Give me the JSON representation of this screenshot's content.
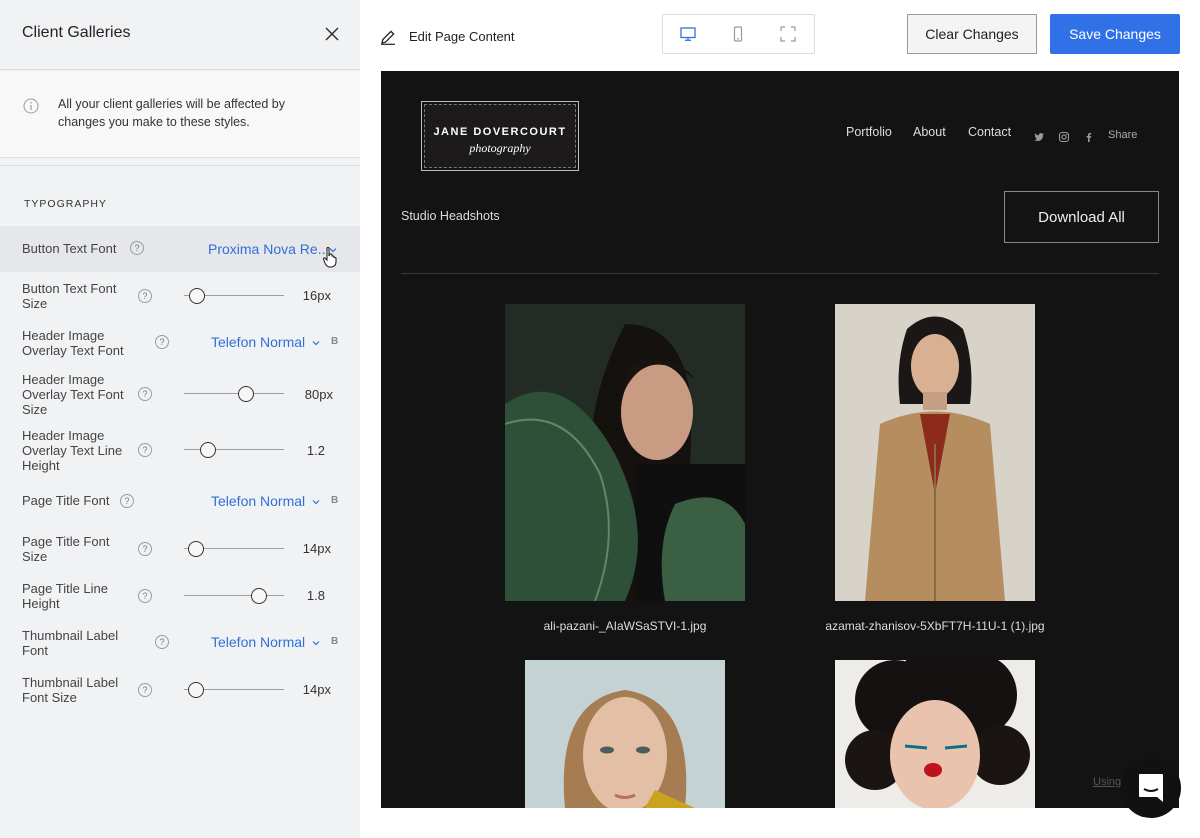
{
  "sidebar": {
    "title": "Client Galleries",
    "info_text": "All your client galleries will be affected by changes you make to these styles.",
    "section_heading": "TYPOGRAPHY",
    "help_glyph": "?",
    "bold_glyph": "B",
    "rows": [
      {
        "label": "Button Text Font",
        "type": "font",
        "value": "Proxima Nova Re..."
      },
      {
        "label": "Button Text Font Size",
        "type": "slider",
        "value": "16px"
      },
      {
        "label": "Header Image Overlay Text Font",
        "type": "font",
        "value": "Telefon Normal"
      },
      {
        "label": "Header Image Overlay Text Font Size",
        "type": "slider",
        "value": "80px"
      },
      {
        "label": "Header Image Overlay Text Line Height",
        "type": "slider",
        "value": "1.2"
      },
      {
        "label": "Page Title Font",
        "type": "font",
        "value": "Telefon Normal"
      },
      {
        "label": "Page Title Font Size",
        "type": "slider",
        "value": "14px"
      },
      {
        "label": "Page Title Line Height",
        "type": "slider",
        "value": "1.8"
      },
      {
        "label": "Thumbnail Label Font",
        "type": "font",
        "value": "Telefon Normal"
      },
      {
        "label": "Thumbnail Label Font Size",
        "type": "slider",
        "value": "14px"
      }
    ]
  },
  "toolbar": {
    "edit_label": "Edit Page Content",
    "clear_label": "Clear Changes",
    "save_label": "Save Changes",
    "devices": [
      "desktop-icon",
      "mobile-icon",
      "fullscreen-icon"
    ]
  },
  "preview": {
    "logo_name": "JANE DOVERCOURT",
    "logo_sub": "photography",
    "nav": [
      "Portfolio",
      "About",
      "Contact"
    ],
    "social_icons": [
      "twitter-icon",
      "instagram-icon",
      "facebook-icon"
    ],
    "share_label": "Share",
    "gallery_title": "Studio Headshots",
    "download_label": "Download All",
    "thumbnails": [
      {
        "label": "ali-pazani-_AIaWSaSTVI-1.jpg"
      },
      {
        "label": "azamat-zhanisov-5XbFT7H-11U-1 (1).jpg"
      },
      {
        "label": ""
      },
      {
        "label": ""
      }
    ],
    "footer_text": "Using"
  },
  "colors": {
    "accent": "#3071e8",
    "link": "#2f6fd8",
    "preview_bg": "#131313",
    "sidebar_bg": "#f1f2f4"
  }
}
